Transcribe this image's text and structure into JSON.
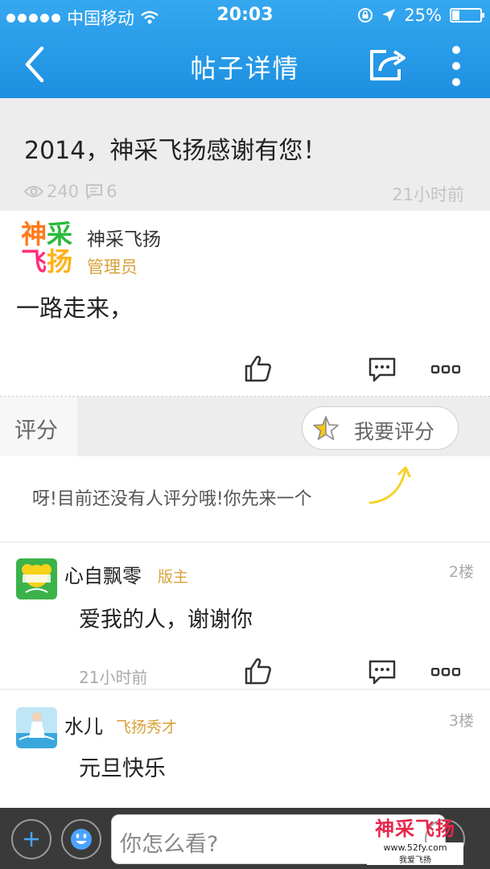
{
  "status_bar": {
    "carrier": "中国移动",
    "time": "20:03",
    "battery": "25%"
  },
  "nav": {
    "title": "帖子详情"
  },
  "post": {
    "title": "2014，神采飞扬感谢有您！",
    "views": "240",
    "comments": "6",
    "time": "21小时前"
  },
  "author": {
    "logo_line1": [
      "神",
      "采"
    ],
    "logo_line2": [
      "飞",
      "扬"
    ],
    "name": "神采飞扬",
    "role": "管理员",
    "body": "一路走来，"
  },
  "rating": {
    "label": "评分",
    "button_label": "我要评分",
    "empty_text": "呀!目前还没有人评分哦!你先来一个"
  },
  "replies": [
    {
      "name": "心自飘零",
      "role": "版主",
      "floor": "2楼",
      "text": "爱我的人，谢谢你",
      "time": "21小时前"
    },
    {
      "name": "水儿",
      "role": "飞扬秀才",
      "floor": "3楼",
      "text": "元旦快乐"
    }
  ],
  "composer": {
    "placeholder": "你怎么看?"
  },
  "watermark": {
    "logo": "神采飞扬",
    "url": "www.52fy.com",
    "sub": "我爱飞扬"
  },
  "colors": {
    "nav_blue": "#1d8fe0",
    "role_gold": "#d8a23a",
    "star_yellow": "#f5c518"
  }
}
